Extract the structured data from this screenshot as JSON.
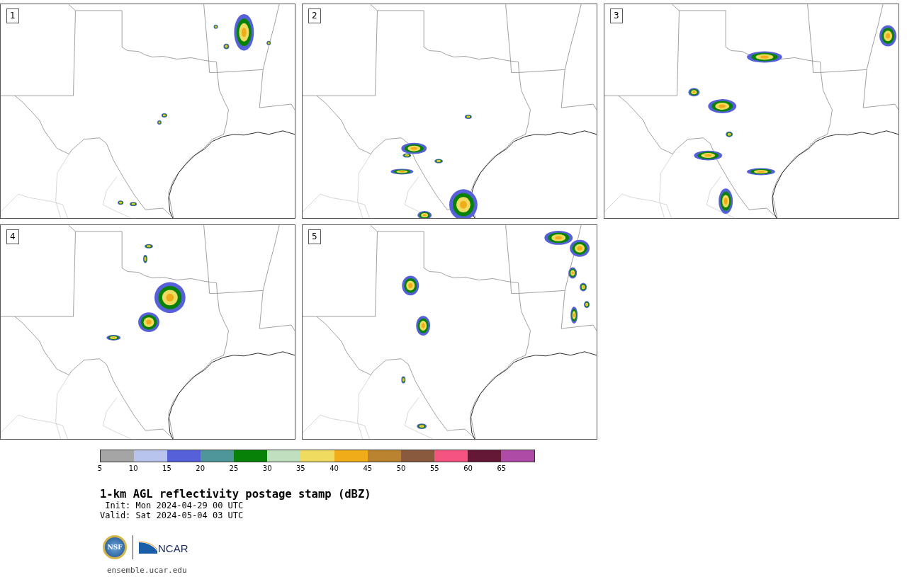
{
  "panels": [
    {
      "label": "1"
    },
    {
      "label": "2"
    },
    {
      "label": "3"
    },
    {
      "label": "4"
    },
    {
      "label": "5"
    }
  ],
  "colorbar": {
    "segments": [
      {
        "color": "#a5a5a5"
      },
      {
        "color": "#b8c3ee"
      },
      {
        "color": "#5661d9"
      },
      {
        "color": "#4f969b"
      },
      {
        "color": "#088108"
      },
      {
        "color": "#bfdfbf"
      },
      {
        "color": "#efdb60"
      },
      {
        "color": "#f0ad19"
      },
      {
        "color": "#b98330"
      },
      {
        "color": "#8a5a3e"
      },
      {
        "color": "#f65480"
      },
      {
        "color": "#651736"
      },
      {
        "color": "#ae4ba6"
      }
    ],
    "ticks": [
      "5",
      "10",
      "15",
      "20",
      "25",
      "30",
      "35",
      "40",
      "45",
      "50",
      "55",
      "60",
      "65"
    ]
  },
  "title": "1-km AGL reflectivity postage stamp (dBZ)",
  "init": " Init: Mon 2024-04-29 00 UTC",
  "valid": "Valid: Sat 2024-05-04 03 UTC",
  "logos": {
    "nsf": "NSF",
    "ncar": "NCAR"
  },
  "url": "ensemble.ucar.edu"
}
